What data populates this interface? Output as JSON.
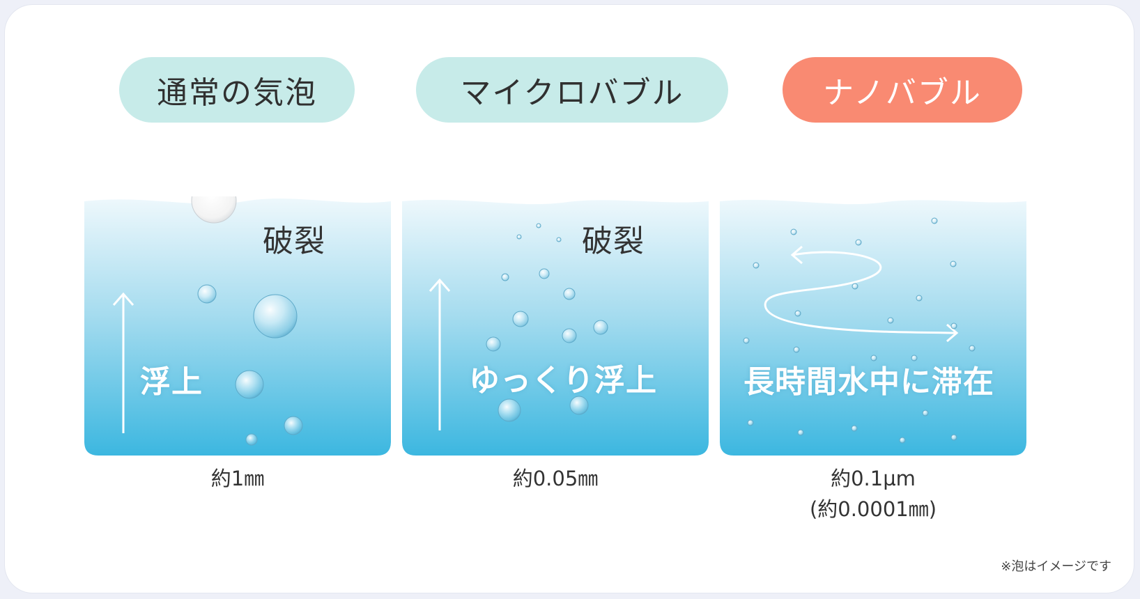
{
  "columns": [
    {
      "title": "通常の気泡",
      "style": "teal",
      "burst": "破裂",
      "motion": "浮上",
      "size": "約1㎜",
      "size2": ""
    },
    {
      "title": "マイクロバブル",
      "style": "teal",
      "burst": "破裂",
      "motion": "ゆっくり浮上",
      "size": "約0.05㎜",
      "size2": ""
    },
    {
      "title": "ナノバブル",
      "style": "coral",
      "burst": "",
      "motion": "長時間水中に滞在",
      "size": "約0.1µm",
      "size2": "(約0.0001㎜)"
    }
  ],
  "footnote": "※泡はイメージです",
  "colors": {
    "teal": "#c7ebe9",
    "coral": "#f98a72",
    "water_top": "#eaf7fb",
    "water_bottom": "#3db8e0"
  }
}
